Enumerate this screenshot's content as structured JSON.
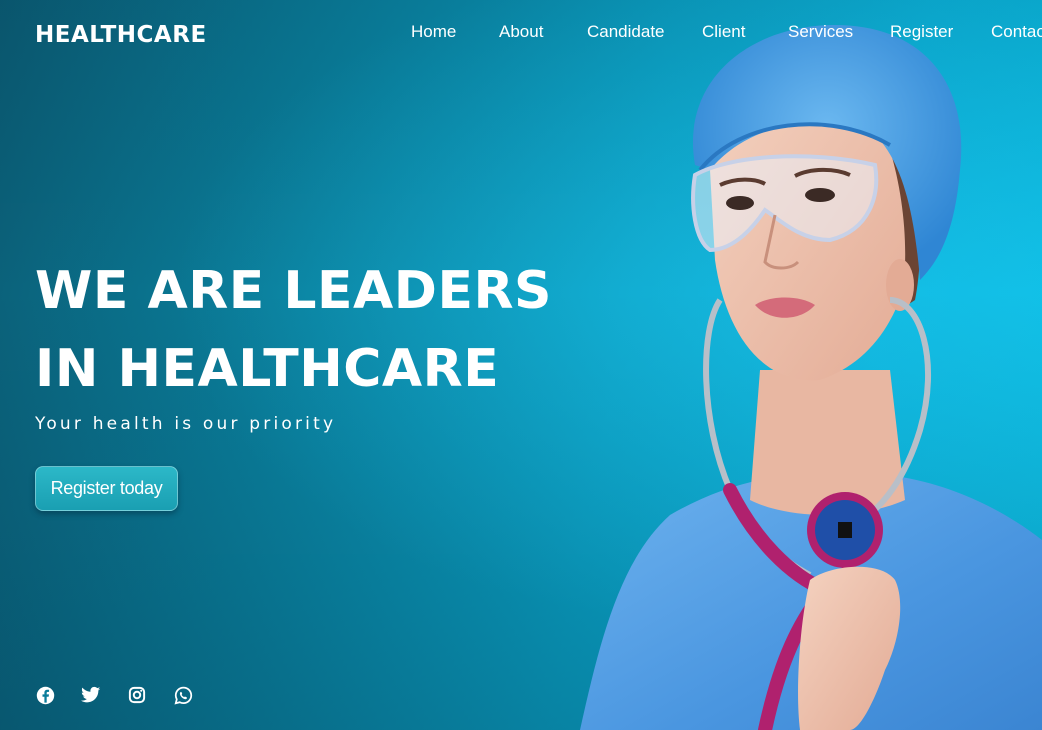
{
  "brand": {
    "logo": "HEALTHCARE"
  },
  "nav": {
    "items": [
      {
        "label": "Home"
      },
      {
        "label": "About"
      },
      {
        "label": "Candidate"
      },
      {
        "label": "Client"
      },
      {
        "label": "Services"
      },
      {
        "label": "Register"
      },
      {
        "label": "Contact"
      }
    ]
  },
  "hero": {
    "headline_line1": "WE ARE LEADERS",
    "headline_line2": "IN HEALTHCARE",
    "tagline": "Your health is our priority",
    "cta_label": "Register today"
  },
  "social": {
    "icons": [
      "facebook-icon",
      "twitter-icon",
      "instagram-icon",
      "whatsapp-icon"
    ]
  },
  "colors": {
    "background_dark": "#0b5d75",
    "background_light": "#0cc2e8",
    "cta": "#1a9fb2",
    "text": "#ffffff",
    "scrubs": "#4a9fe0",
    "stethoscope": "#b0216e"
  }
}
